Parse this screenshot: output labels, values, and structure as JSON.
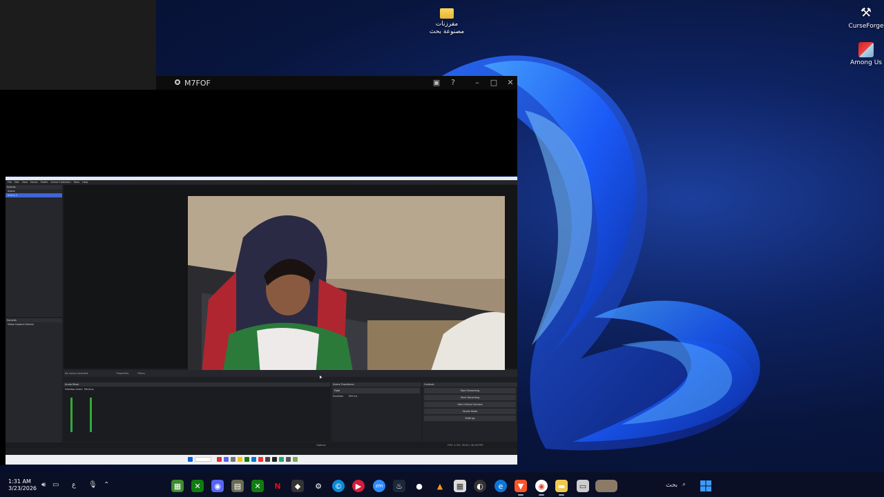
{
  "desktop": {
    "icons": [
      {
        "label_line1": "مفرزنات",
        "label_line2": "مصنوعة بحث",
        "icon": "folder-icon"
      },
      {
        "label": "CurseForge",
        "icon": "curseforge-icon"
      },
      {
        "label": "Among Us",
        "icon": "among-us-icon"
      }
    ]
  },
  "mirror_window": {
    "title": "M7FOF",
    "controls": [
      "minimize",
      "maximize",
      "close"
    ]
  },
  "obs": {
    "menu": [
      "File",
      "Edit",
      "View",
      "Docks",
      "Profile",
      "Scene Collection",
      "Tools",
      "Help"
    ],
    "scenes_header": "Scenes",
    "scenes": [
      "Scene",
      "Scene 2"
    ],
    "selected_scene_index": 1,
    "sources_header": "Sources",
    "sources": [
      "Video Capture Device"
    ],
    "no_source": "No source selected",
    "properties_label": "Properties",
    "filters_label": "Filters",
    "audio_mixer_header": "Audio Mixer",
    "mixer_channels": [
      "Desktop Audio",
      "Mic/Aux"
    ],
    "transitions_header": "Scene Transitions",
    "transition_value": "Fade",
    "duration_label": "Duration",
    "duration_value": "300 ms",
    "controls_header": "Controls",
    "control_buttons": [
      "Start Streaming",
      "Start Recording",
      "Start Virtual Camera",
      "Studio Mode",
      "Settings"
    ],
    "options_label": "Options",
    "status": "CPU: 4.3%, 30.00 / 30.00 FPS"
  },
  "taskbar": {
    "time": "1:31 AM",
    "date": "3/23/2026",
    "search_placeholder": "بحث",
    "lang": "ع",
    "colors": {
      "accent": "#0b62d6"
    }
  }
}
